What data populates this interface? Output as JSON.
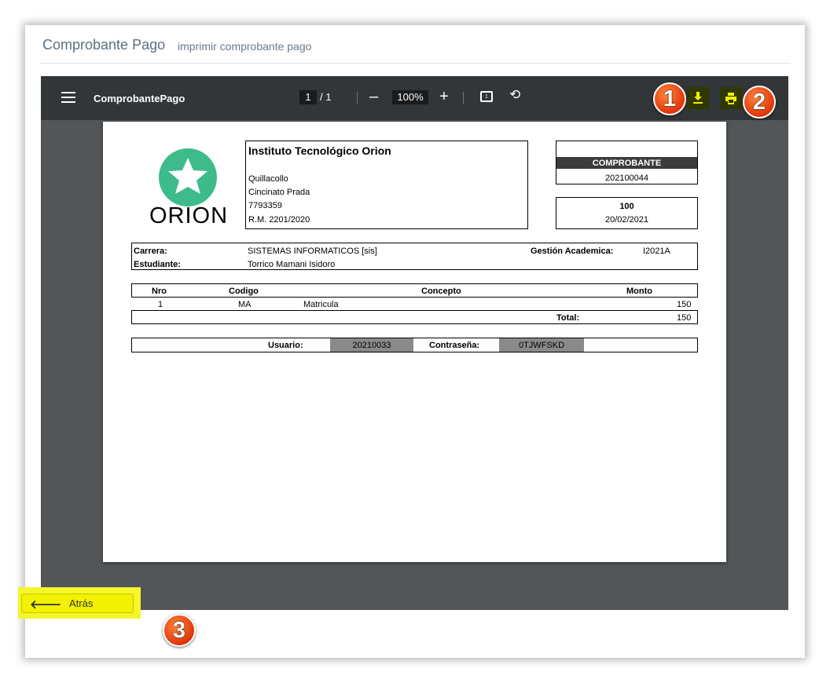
{
  "header": {
    "title": "Comprobante Pago",
    "subtitle": "imprimir comprobante pago"
  },
  "viewer": {
    "file_title": "ComprobantePago",
    "current_page": "1",
    "page_total": "/ 1",
    "zoom": "100%",
    "icons": {
      "menu": "menu-icon",
      "zoom_out": "minus-icon",
      "zoom_in": "plus-icon",
      "fit": "fit-page-icon",
      "rotate": "rotate-icon",
      "download": "download-icon",
      "print": "print-icon"
    }
  },
  "annotations": {
    "badge1": "1",
    "badge2": "2",
    "badge3": "3"
  },
  "document": {
    "logo_text": "ORION",
    "institute": {
      "name": "Instituto Tecnológico Orion",
      "city": "Quillacollo",
      "street": "Cincinato Prada",
      "phone": "7793359",
      "rm": "R.M. 2201/2020"
    },
    "comprobante": {
      "label": "COMPROBANTE",
      "number": "202100044"
    },
    "amount_box": {
      "amount": "100",
      "date": "20/02/2021"
    },
    "info": {
      "carrera_label": "Carrera:",
      "carrera_value": "SISTEMAS INFORMATICOS [sis]",
      "gestion_label": "Gestión Academica:",
      "gestion_value": "I2021A",
      "estudiante_label": "Estudiante:",
      "estudiante_value": "Torrico  Mamani Isidoro"
    },
    "table": {
      "headers": [
        "Nro",
        "Codigo",
        "Concepto",
        "Monto"
      ],
      "rows": [
        {
          "nro": "1",
          "codigo": "MA",
          "concepto": "Matricula",
          "monto": "150"
        }
      ],
      "total_label": "Total:",
      "total_value": "150"
    },
    "credentials": {
      "usuario_label": "Usuario:",
      "usuario_value": "20210033",
      "password_label": "Contraseña:",
      "password_value": "0TJWFSKD"
    }
  },
  "footer": {
    "back_label": "Atrás"
  },
  "colors": {
    "logo_green": "#3dbb8b",
    "highlight_yellow": "#f4f52a",
    "badge_orange": "#e1340b"
  }
}
